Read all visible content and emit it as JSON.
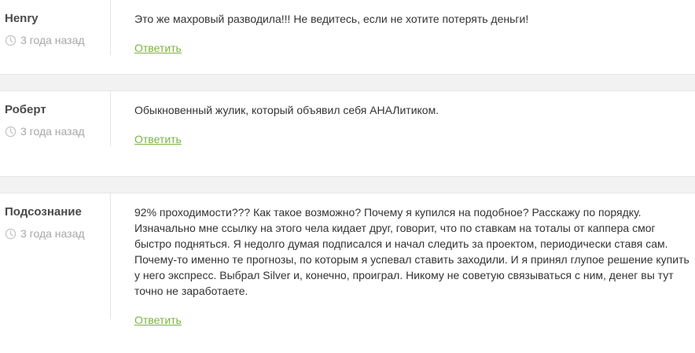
{
  "comments": [
    {
      "author": "Henry",
      "time": "3 года назад",
      "text": "Это же махровый разводила!!! Не ведитесь, если не хотите потерять деньги!",
      "reply_label": "Ответить"
    },
    {
      "author": "Роберт",
      "time": "3 года назад",
      "text": "Обыкновенный жулик, который объявил себя АНАЛитиком.",
      "reply_label": "Ответить"
    },
    {
      "author": "Подсознание",
      "time": "3 года назад",
      "text": "92% проходимости??? Как такое возможно? Почему я купился на подобное? Расскажу по порядку. Изначально мне ссылку на этого чела кидает друг, говорит, что по ставкам на тоталы от каппера смог быстро подняться. Я недолго думая подписался и начал следить за проектом, периодически ставя сам. Почему-то именно те прогнозы, по которым я успевал ставить заходили. И я принял глупое решение купить у него экспресс. Выбрал Silver и, конечно, проиграл. Никому не советую связываться с ним, денег вы тут точно не заработаете.",
      "reply_label": "Ответить"
    }
  ],
  "colors": {
    "link": "#7cb342",
    "separator": "#f2f2f2",
    "muted": "#a7a7a7"
  },
  "icons": {
    "time": "clock-icon"
  }
}
